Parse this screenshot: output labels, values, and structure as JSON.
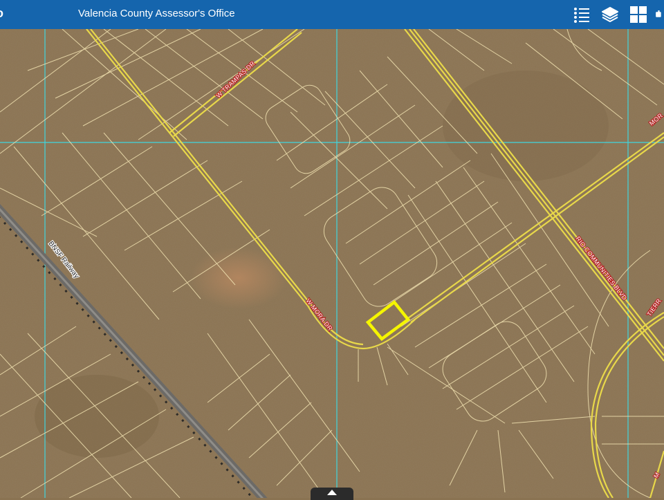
{
  "header": {
    "app_glyph": "o",
    "title": "Valencia County Assessor's Office",
    "bg_color": "#1565ad"
  },
  "toolbar": {
    "buttons": [
      {
        "icon": "legend-list-icon"
      },
      {
        "icon": "layers-icon"
      },
      {
        "icon": "basemap-gallery-icon"
      },
      {
        "icon": "share-icon"
      }
    ]
  },
  "map": {
    "streets": {
      "trampas": "W TRAMPAS DR",
      "mora": "W MORA DR",
      "rio_communities": "RIO COMMUNITIES BLVD",
      "mo_top": "MOR",
      "tierra": "TIERR",
      "mo_bottom": "M"
    },
    "railway_label": "BNSF Railway",
    "colors": {
      "parcel_lines": "#f3e4b3",
      "road_lines": "#e8d84a",
      "grid_lines": "#3fd6df",
      "selected_parcel": "#f5f500",
      "railway": "#6c6a67"
    }
  },
  "expand_tab": {
    "icon": "chevron-up-icon"
  }
}
